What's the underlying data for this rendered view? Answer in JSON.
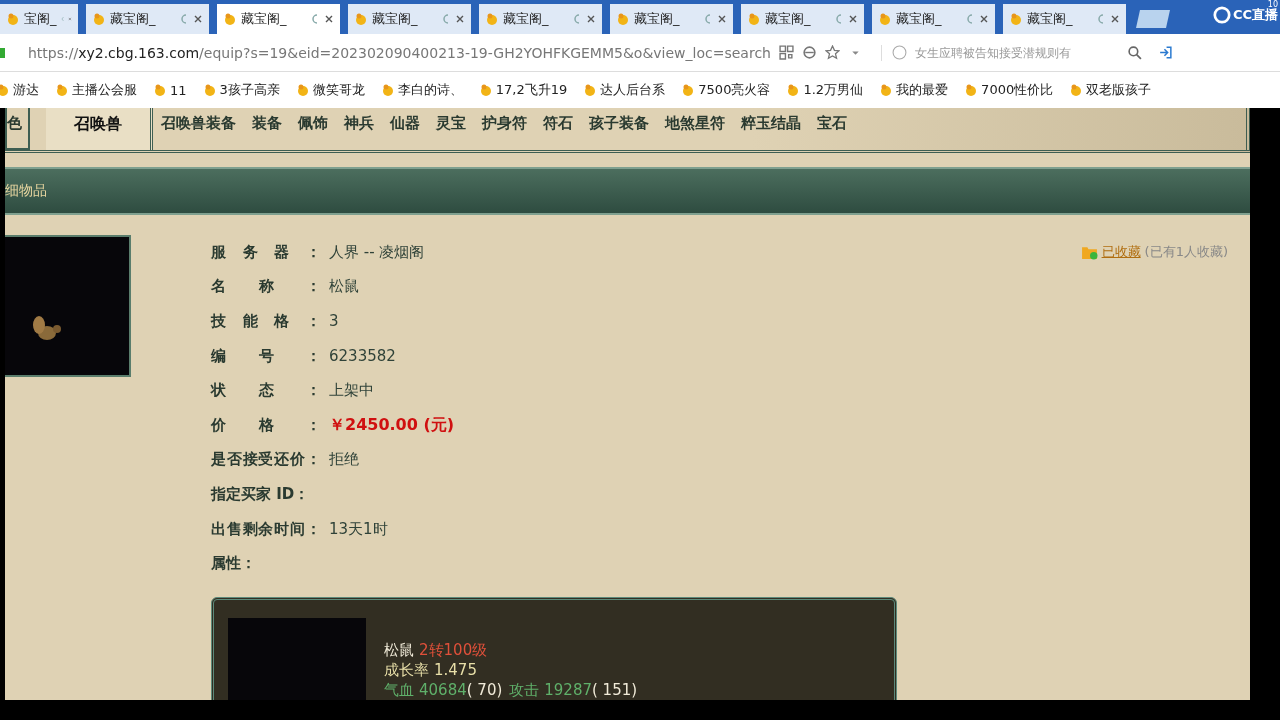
{
  "browser": {
    "tabs": [
      {
        "title": "宝阁_",
        "selected": false
      },
      {
        "title": "藏宝阁_",
        "selected": false
      },
      {
        "title": "藏宝阁_",
        "selected": true
      },
      {
        "title": "藏宝阁_",
        "selected": false
      },
      {
        "title": "藏宝阁_",
        "selected": false
      },
      {
        "title": "藏宝阁_",
        "selected": false
      },
      {
        "title": "藏宝阁_",
        "selected": false
      },
      {
        "title": "藏宝阁_",
        "selected": false
      },
      {
        "title": "藏宝阁_",
        "selected": false
      }
    ],
    "overlay": {
      "brand": "CC直播",
      "count": "10"
    },
    "url": {
      "scheme": "https://",
      "host": "xy2.cbg.163.com",
      "path": "/equip?s=19&eid=202302090400213-19-GH2YOHFKGEMM5&o&view_loc=search"
    },
    "search": {
      "placeholder": "女生应聘被告知接受潜规则有"
    },
    "bookmarks": [
      "游达",
      "主播公会服",
      "11",
      "3孩子高亲",
      "微笑哥龙",
      "李白的诗、",
      "17,2飞升19",
      "达人后台系",
      "7500亮火容",
      "1.2万男仙",
      "我的最爱",
      "7000性价比",
      "双老版孩子"
    ]
  },
  "nav": [
    {
      "label": "色",
      "selected": false
    },
    {
      "label": "召唤兽",
      "selected": true
    },
    {
      "label": "召唤兽装备",
      "selected": false
    },
    {
      "label": "装备",
      "selected": false
    },
    {
      "label": "佩饰",
      "selected": false
    },
    {
      "label": "神兵",
      "selected": false
    },
    {
      "label": "仙器",
      "selected": false
    },
    {
      "label": "灵宝",
      "selected": false
    },
    {
      "label": "护身符",
      "selected": false
    },
    {
      "label": "符石",
      "selected": false
    },
    {
      "label": "孩子装备",
      "selected": false
    },
    {
      "label": "地煞星符",
      "selected": false
    },
    {
      "label": "粹玉结晶",
      "selected": false
    },
    {
      "label": "宝石",
      "selected": false
    }
  ],
  "panel_title": "细物品",
  "favorite": {
    "link": "已收藏",
    "count": "(已有1人收藏)"
  },
  "details": [
    {
      "kind": "field",
      "label": "服务器：",
      "value": "人界 -- 凌烟阁"
    },
    {
      "kind": "field",
      "label": "名称：",
      "value": "松鼠"
    },
    {
      "kind": "field",
      "label": "技能格：",
      "value": "3"
    },
    {
      "kind": "field",
      "label": "编号：",
      "value": "6233582"
    },
    {
      "kind": "field",
      "label": "状态：",
      "value": "上架中"
    },
    {
      "kind": "price",
      "label": "价格：",
      "value": "￥2450.00 (元)"
    },
    {
      "kind": "field",
      "label": "是否接受还价：",
      "value": "拒绝"
    },
    {
      "kind": "heading",
      "label": "指定买家 ID："
    },
    {
      "kind": "field",
      "label": "出售剩余时间：",
      "value": "13天1时"
    },
    {
      "kind": "heading",
      "label": "属性："
    }
  ],
  "pet": {
    "name": "松鼠",
    "level": "2转100级",
    "growth_label": "成长率",
    "growth": "1.475",
    "stats": [
      {
        "label": "气血",
        "value": "40684",
        "extra": "( 70)"
      },
      {
        "label": "攻击",
        "value": "19287",
        "extra": "( 151)"
      }
    ]
  }
}
